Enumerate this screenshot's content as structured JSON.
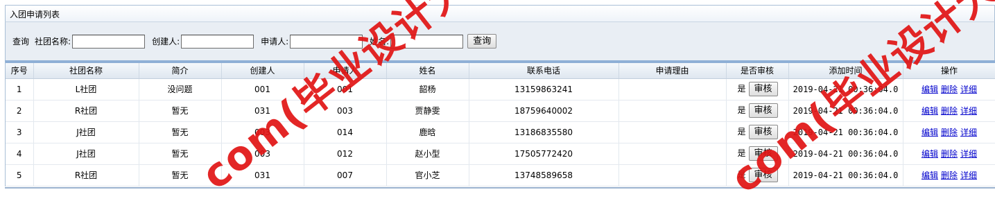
{
  "title": "入团申请列表",
  "search": {
    "query_label": "查询",
    "club_label": "社团名称:",
    "creator_label": "创建人:",
    "applicant_label": "申请人:",
    "name_label": "姓名:",
    "club_value": "",
    "creator_value": "",
    "applicant_value": "",
    "name_value": "",
    "button_label": "查询"
  },
  "table": {
    "headers": [
      "序号",
      "社团名称",
      "简介",
      "创建人",
      "申请人",
      "姓名",
      "联系电话",
      "申请理由",
      "是否审核",
      "添加时间",
      "操作"
    ],
    "rows": [
      {
        "no": "1",
        "club": "L社团",
        "intro": "没问题",
        "creator": "001",
        "applicant": "001",
        "name": "韶杨",
        "phone": "13159863241",
        "reason": "",
        "audited": "是",
        "audit_btn": "审核",
        "time": "2019-04-21 00:36:04.0"
      },
      {
        "no": "2",
        "club": "R社团",
        "intro": "暂无",
        "creator": "031",
        "applicant": "003",
        "name": "贾静雯",
        "phone": "18759640002",
        "reason": "",
        "audited": "是",
        "audit_btn": "审核",
        "time": "2019-04-21 00:36:04.0"
      },
      {
        "no": "3",
        "club": "J社团",
        "intro": "暂无",
        "creator": "003",
        "applicant": "014",
        "name": "鹿晗",
        "phone": "13186835580",
        "reason": "",
        "audited": "是",
        "audit_btn": "审核",
        "time": "2019-04-21 00:36:04.0"
      },
      {
        "no": "4",
        "club": "J社团",
        "intro": "暂无",
        "creator": "003",
        "applicant": "012",
        "name": "赵小型",
        "phone": "17505772420",
        "reason": "",
        "audited": "是",
        "audit_btn": "审核",
        "time": "2019-04-21 00:36:04.0"
      },
      {
        "no": "5",
        "club": "R社团",
        "intro": "暂无",
        "creator": "031",
        "applicant": "007",
        "name": "官小芝",
        "phone": "13748589658",
        "reason": "",
        "audited": "是",
        "audit_btn": "审核",
        "time": "2019-04-21 00:36:04.0"
      }
    ],
    "ops": {
      "edit": "编辑",
      "delete": "删除",
      "detail": "详细"
    }
  },
  "watermark": {
    "text": "com(毕业设计大全)",
    "text2": "com(毕业设计大",
    "color": "#e11414"
  }
}
